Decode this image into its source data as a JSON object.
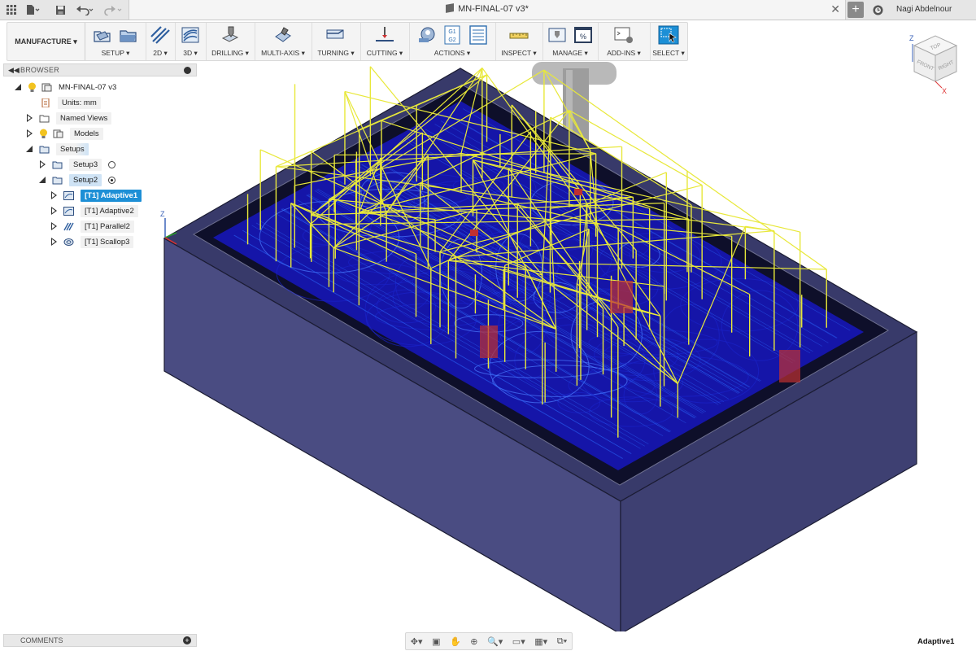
{
  "titlebar": {
    "document_title": "MN-FINAL-07 v3*",
    "user_name": "Nagi Abdelnour",
    "icons": [
      "grid-icon",
      "file-icon",
      "save-icon",
      "undo-icon",
      "redo-icon",
      "close-icon",
      "plus-icon",
      "clock-icon"
    ]
  },
  "ribbon": {
    "workspace": "MANUFACTURE",
    "groups": [
      {
        "label": "SETUP ▾"
      },
      {
        "label": "2D ▾"
      },
      {
        "label": "3D ▾"
      },
      {
        "label": "DRILLING ▾"
      },
      {
        "label": "MULTI-AXIS ▾"
      },
      {
        "label": "TURNING ▾"
      },
      {
        "label": "CUTTING ▾"
      },
      {
        "label": "ACTIONS ▾"
      },
      {
        "label": "INSPECT ▾"
      },
      {
        "label": "MANAGE ▾"
      },
      {
        "label": "ADD-INS ▾"
      },
      {
        "label": "SELECT ▾"
      }
    ],
    "actions_icon_text": "G1 G2"
  },
  "browser": {
    "title": "BROWSER",
    "tree": [
      {
        "label": "MN-FINAL-07 v3"
      },
      {
        "label": "Units: mm"
      },
      {
        "label": "Named Views"
      },
      {
        "label": "Models"
      },
      {
        "label": "Setups"
      },
      {
        "label": "Setup3"
      },
      {
        "label": "Setup2"
      },
      {
        "label": "[T1] Adaptive1"
      },
      {
        "label": "[T1] Adaptive2"
      },
      {
        "label": "[T1] Parallel2"
      },
      {
        "label": "[T1] Scallop3"
      }
    ]
  },
  "comments": {
    "title": "COMMENTS"
  },
  "viewcube": {
    "top": "TOP",
    "front": "FRONT",
    "right": "RIGHT",
    "axis_z": "Z",
    "axis_x": "X"
  },
  "viewport": {
    "axis_z": "Z",
    "stock_color": "#3d3f6e",
    "toolpath_color": "#e8e83a",
    "pass_color": "#1a22c8"
  },
  "status": {
    "active_operation": "Adaptive1"
  }
}
